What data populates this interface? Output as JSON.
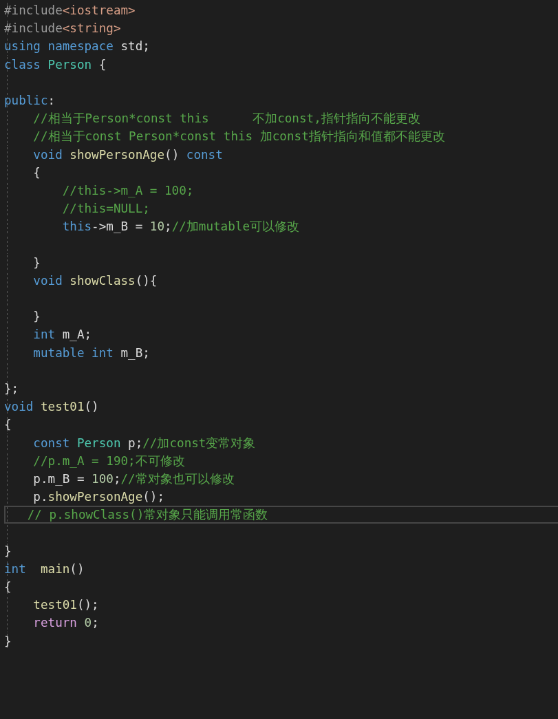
{
  "editor": {
    "lines": [
      {
        "current": false,
        "tokens": [
          {
            "text": "#include",
            "kind": "preprocessor"
          },
          {
            "text": "<iostream>",
            "kind": "string"
          }
        ]
      },
      {
        "current": false,
        "tokens": [
          {
            "text": "#include",
            "kind": "preprocessor"
          },
          {
            "text": "<string>",
            "kind": "string"
          }
        ]
      },
      {
        "current": false,
        "tokens": [
          {
            "text": "using namespace",
            "kind": "keyword"
          },
          {
            "text": " std;",
            "kind": "plain"
          }
        ]
      },
      {
        "current": false,
        "tokens": [
          {
            "text": "class",
            "kind": "keyword"
          },
          {
            "text": " Person",
            "kind": "type"
          },
          {
            "text": " {",
            "kind": "plain"
          }
        ]
      },
      {
        "current": false
      },
      {
        "current": false,
        "tokens": [
          {
            "text": "public",
            "kind": "keyword"
          },
          {
            "text": ":",
            "kind": "plain"
          }
        ]
      },
      {
        "current": false,
        "tokens": [
          {
            "text": "    //相当于Person*const this      不加const,指针指向不能更改",
            "kind": "comment"
          }
        ]
      },
      {
        "current": false,
        "tokens": [
          {
            "text": "    //相当于const Person*const this 加const指针指向和值都不能更改",
            "kind": "comment"
          }
        ]
      },
      {
        "current": false,
        "tokens": [
          {
            "text": "    void",
            "kind": "keyword"
          },
          {
            "text": " showPersonAge",
            "kind": "function"
          },
          {
            "text": "() ",
            "kind": "plain"
          },
          {
            "text": "const",
            "kind": "keyword"
          }
        ]
      },
      {
        "current": false,
        "tokens": [
          {
            "text": "    {",
            "kind": "plain"
          }
        ]
      },
      {
        "current": false,
        "tokens": [
          {
            "text": "        //this->m_A = 100;",
            "kind": "comment"
          }
        ]
      },
      {
        "current": false,
        "tokens": [
          {
            "text": "        //this=NULL;",
            "kind": "comment"
          }
        ]
      },
      {
        "current": false,
        "tokens": [
          {
            "text": "        this",
            "kind": "keyword"
          },
          {
            "text": "->m_B = ",
            "kind": "plain"
          },
          {
            "text": "10",
            "kind": "number"
          },
          {
            "text": ";",
            "kind": "plain"
          },
          {
            "text": "//加mutable可以修改",
            "kind": "comment"
          }
        ]
      },
      {
        "current": false
      },
      {
        "current": false,
        "tokens": [
          {
            "text": "    }",
            "kind": "plain"
          }
        ]
      },
      {
        "current": false,
        "tokens": [
          {
            "text": "    void",
            "kind": "keyword"
          },
          {
            "text": " showClass",
            "kind": "function"
          },
          {
            "text": "(){",
            "kind": "plain"
          }
        ]
      },
      {
        "current": false
      },
      {
        "current": false,
        "tokens": [
          {
            "text": "    }",
            "kind": "plain"
          }
        ]
      },
      {
        "current": false,
        "tokens": [
          {
            "text": "    int",
            "kind": "keyword"
          },
          {
            "text": " m_A;",
            "kind": "plain"
          }
        ]
      },
      {
        "current": false,
        "tokens": [
          {
            "text": "    mutable int",
            "kind": "keyword"
          },
          {
            "text": " m_B;",
            "kind": "plain"
          }
        ]
      },
      {
        "current": false
      },
      {
        "current": false,
        "tokens": [
          {
            "text": "};",
            "kind": "plain"
          }
        ]
      },
      {
        "current": false,
        "tokens": [
          {
            "text": "void",
            "kind": "keyword"
          },
          {
            "text": " test01",
            "kind": "function"
          },
          {
            "text": "()",
            "kind": "plain"
          }
        ]
      },
      {
        "current": false,
        "tokens": [
          {
            "text": "{",
            "kind": "plain"
          }
        ]
      },
      {
        "current": false,
        "tokens": [
          {
            "text": "    const",
            "kind": "keyword"
          },
          {
            "text": " Person",
            "kind": "type"
          },
          {
            "text": " p;",
            "kind": "plain"
          },
          {
            "text": "//加const变常对象",
            "kind": "comment"
          }
        ]
      },
      {
        "current": false,
        "tokens": [
          {
            "text": "    //p.m_A = 190;不可修改",
            "kind": "comment"
          }
        ]
      },
      {
        "current": false,
        "tokens": [
          {
            "text": "    p.m_B = ",
            "kind": "plain"
          },
          {
            "text": "100",
            "kind": "number"
          },
          {
            "text": ";",
            "kind": "plain"
          },
          {
            "text": "//常对象也可以修改",
            "kind": "comment"
          }
        ]
      },
      {
        "current": false,
        "tokens": [
          {
            "text": "    p.",
            "kind": "plain"
          },
          {
            "text": "showPersonAge",
            "kind": "function"
          },
          {
            "text": "();",
            "kind": "plain"
          }
        ]
      },
      {
        "current": true,
        "tokens": [
          {
            "text": "   // p.showClass()常对象只能调用常函数",
            "kind": "comment"
          }
        ]
      },
      {
        "current": false
      },
      {
        "current": false,
        "tokens": [
          {
            "text": "}",
            "kind": "plain"
          }
        ]
      },
      {
        "current": false,
        "tokens": [
          {
            "text": "int",
            "kind": "keyword"
          },
          {
            "text": "  main",
            "kind": "function"
          },
          {
            "text": "()",
            "kind": "plain"
          }
        ]
      },
      {
        "current": false,
        "tokens": [
          {
            "text": "{",
            "kind": "plain"
          }
        ]
      },
      {
        "current": false,
        "tokens": [
          {
            "text": "    test01",
            "kind": "function"
          },
          {
            "text": "();",
            "kind": "plain"
          }
        ]
      },
      {
        "current": false,
        "tokens": [
          {
            "text": "    return",
            "kind": "control"
          },
          {
            "text": " 0",
            "kind": "number"
          },
          {
            "text": ";",
            "kind": "plain"
          }
        ]
      },
      {
        "current": false,
        "tokens": [
          {
            "text": "}",
            "kind": "plain"
          }
        ]
      }
    ]
  }
}
